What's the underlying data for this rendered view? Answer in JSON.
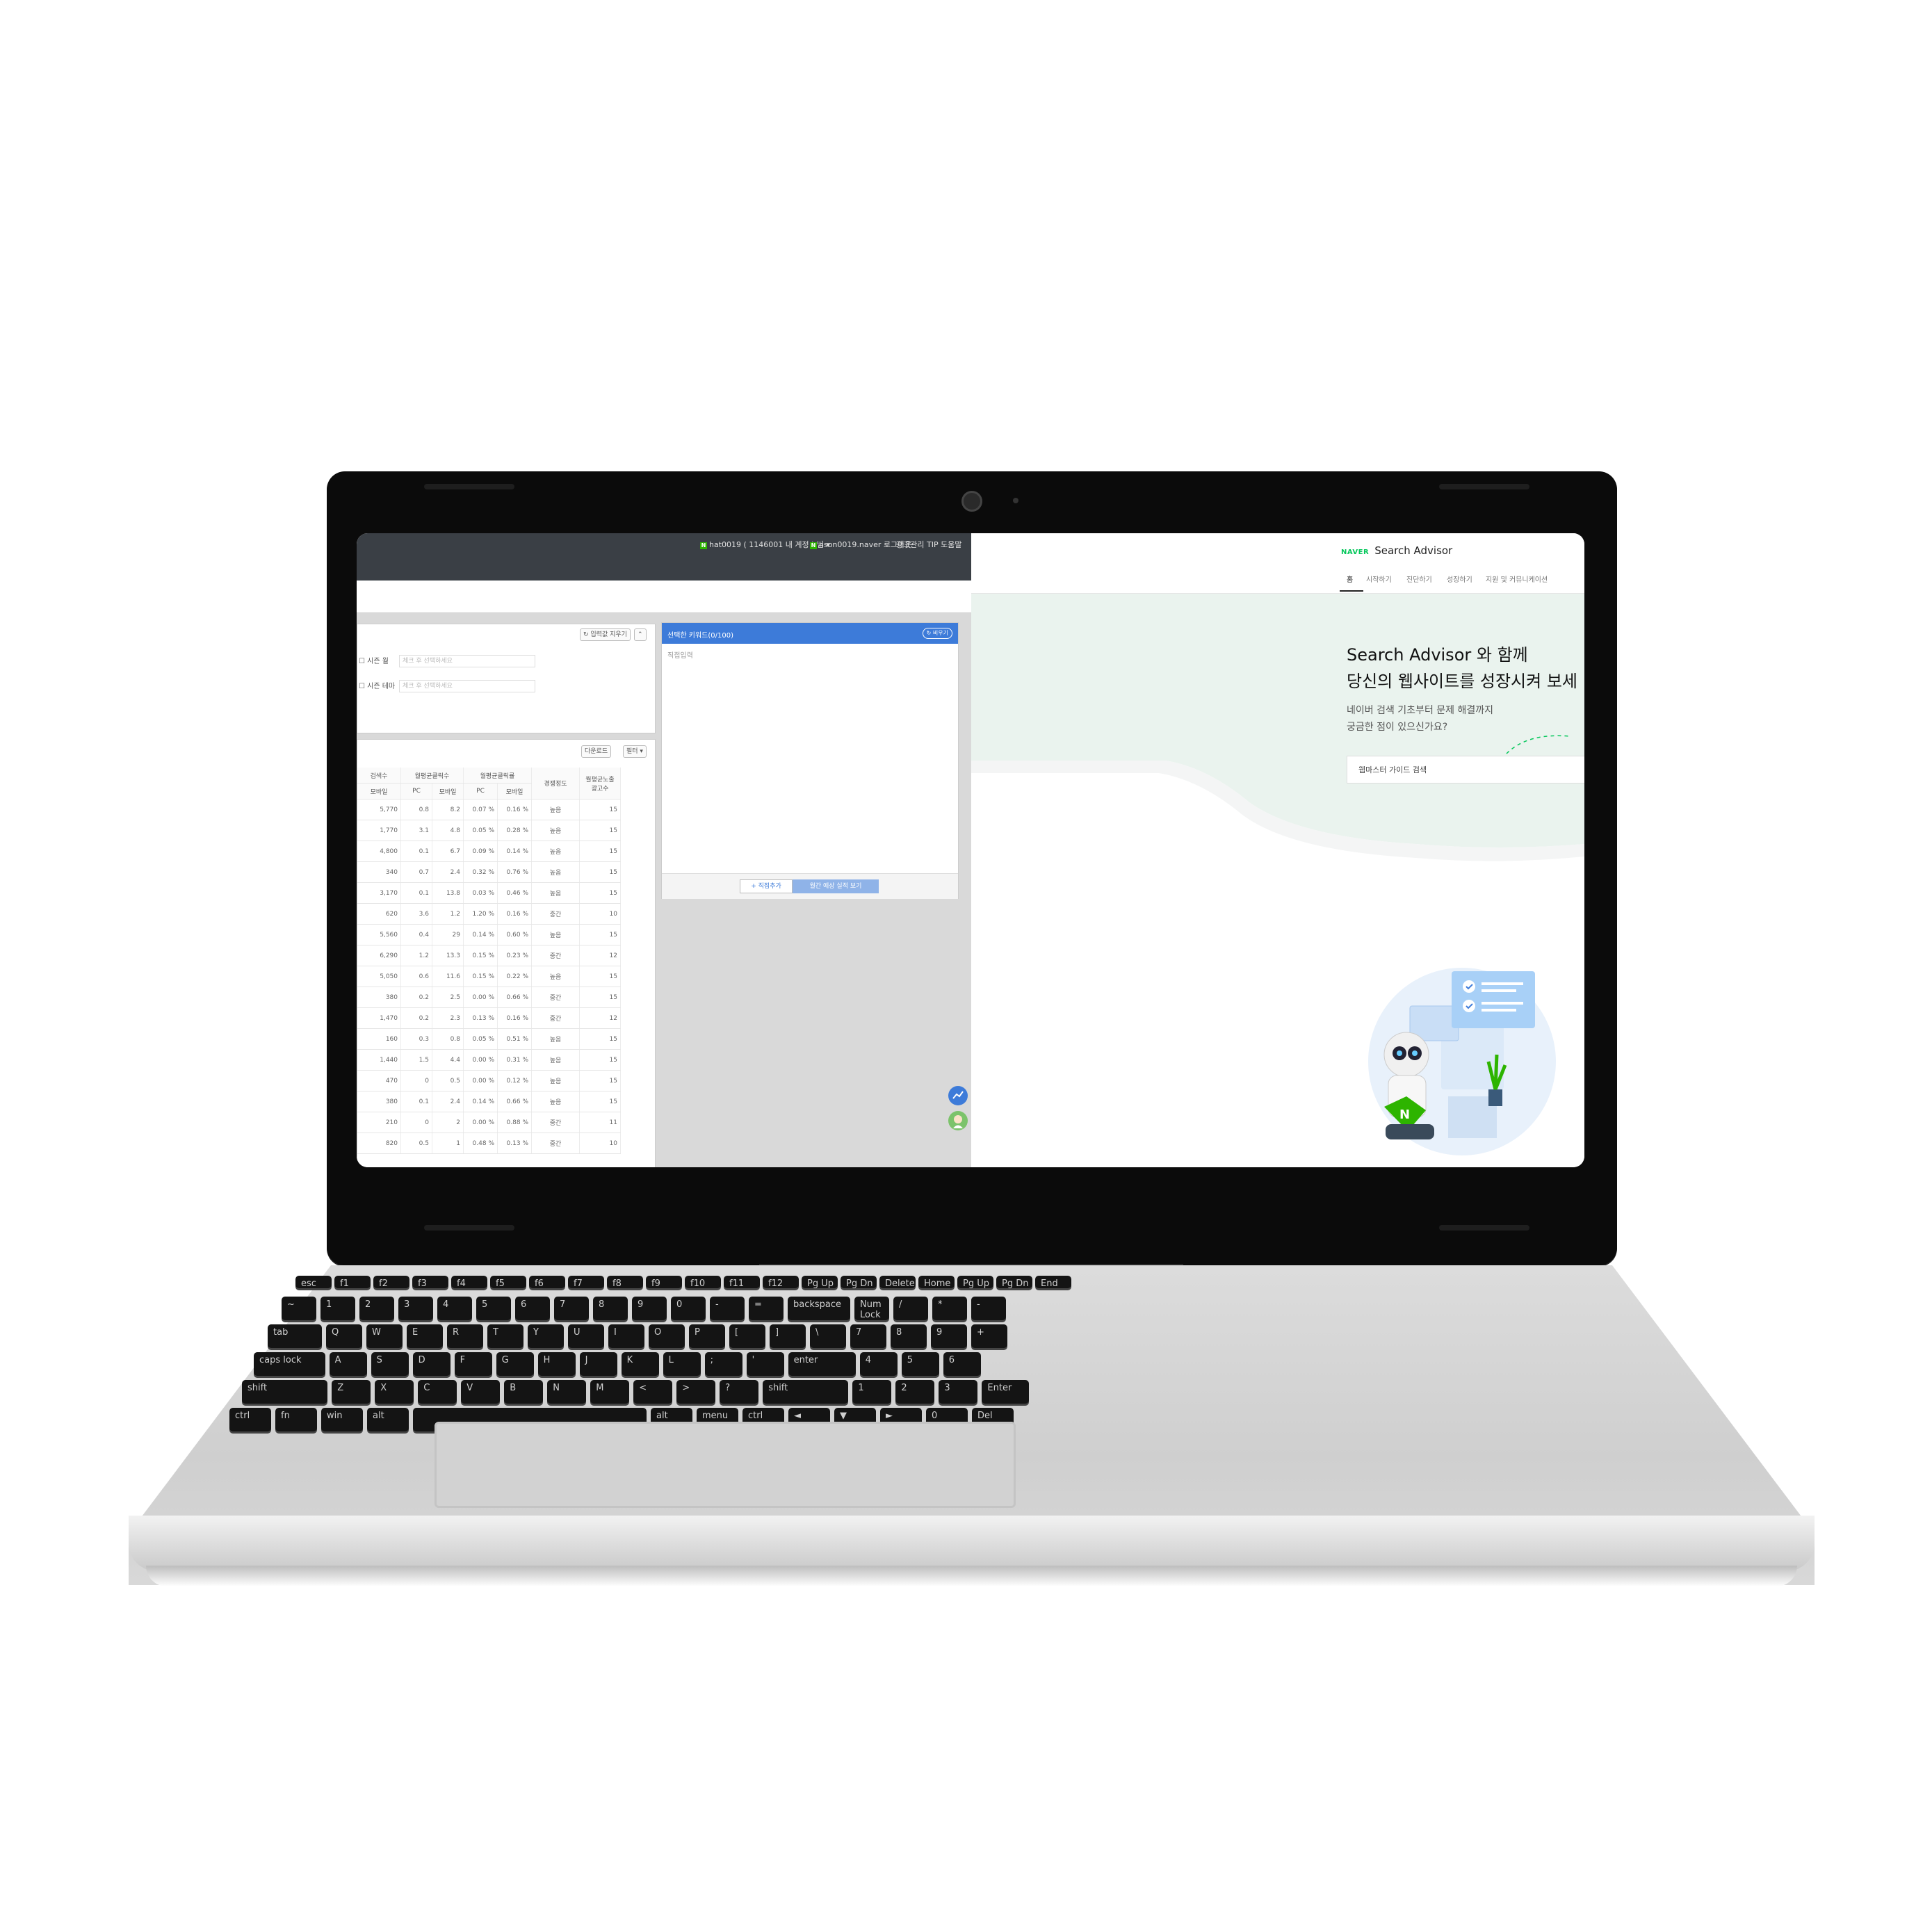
{
  "left_window": {
    "topbar": {
      "account_label": "hat0019 ( 1146001 내 계정 ) 님",
      "login_label": "hson0019.naver 로그아웃",
      "tip_label": "광고관리 TIP",
      "help_label": "도움말"
    },
    "filters": {
      "refresh_label": "입력값 지우기",
      "row1_label": "시즌 월",
      "row1_placeholder": "체크 후 선택하세요",
      "row2_label": "시즌 테마",
      "row2_placeholder": "체크 후 선택하세요"
    },
    "table_tools": {
      "download_label": "다운로드",
      "filter_label": "필터"
    },
    "table": {
      "group_headers": [
        "검색수",
        "월평균클릭수",
        "월평균클릭률",
        "경쟁정도",
        "월평균노출 광고수"
      ],
      "sub_headers": [
        "모바일",
        "PC",
        "모바일",
        "PC",
        "모바일"
      ],
      "rows": [
        [
          "5,770",
          "0.8",
          "8.2",
          "0.07 %",
          "0.16 %",
          "높음",
          "15"
        ],
        [
          "1,770",
          "3.1",
          "4.8",
          "0.05 %",
          "0.28 %",
          "높음",
          "15"
        ],
        [
          "4,800",
          "0.1",
          "6.7",
          "0.09 %",
          "0.14 %",
          "높음",
          "15"
        ],
        [
          "340",
          "0.7",
          "2.4",
          "0.32 %",
          "0.76 %",
          "높음",
          "15"
        ],
        [
          "3,170",
          "0.1",
          "13.8",
          "0.03 %",
          "0.46 %",
          "높음",
          "15"
        ],
        [
          "620",
          "3.6",
          "1.2",
          "1.20 %",
          "0.16 %",
          "중간",
          "10"
        ],
        [
          "5,560",
          "0.4",
          "29",
          "0.14 %",
          "0.60 %",
          "높음",
          "15"
        ],
        [
          "6,290",
          "1.2",
          "13.3",
          "0.15 %",
          "0.23 %",
          "중간",
          "12"
        ],
        [
          "5,050",
          "0.6",
          "11.6",
          "0.15 %",
          "0.22 %",
          "높음",
          "15"
        ],
        [
          "380",
          "0.2",
          "2.5",
          "0.00 %",
          "0.66 %",
          "중간",
          "15"
        ],
        [
          "1,470",
          "0.2",
          "2.3",
          "0.13 %",
          "0.16 %",
          "중간",
          "12"
        ],
        [
          "160",
          "0.3",
          "0.8",
          "0.05 %",
          "0.51 %",
          "높음",
          "15"
        ],
        [
          "1,440",
          "1.5",
          "4.4",
          "0.00 %",
          "0.31 %",
          "높음",
          "15"
        ],
        [
          "470",
          "0",
          "0.5",
          "0.00 %",
          "0.12 %",
          "높음",
          "15"
        ],
        [
          "380",
          "0.1",
          "2.4",
          "0.14 %",
          "0.66 %",
          "높음",
          "15"
        ],
        [
          "210",
          "0",
          "2",
          "0.00 %",
          "0.88 %",
          "중간",
          "11"
        ],
        [
          "820",
          "0.5",
          "1",
          "0.48 %",
          "0.13 %",
          "중간",
          "10"
        ]
      ]
    },
    "selected_panel": {
      "title": "선택한 키워드(0/100)",
      "reset_label": "비우기",
      "placeholder": "직접입력",
      "add_label": "+ 직접추가",
      "estimate_label": "월간 예상 실적 보기"
    },
    "colors": {
      "accent": "#3d7bd9",
      "topbar": "#3a3f45",
      "naver_green": "#2db400"
    }
  },
  "right_window": {
    "brand": "NAVER",
    "product": "Search Advisor",
    "nav": [
      "홈",
      "시작하기",
      "진단하기",
      "성장하기",
      "지원 및 커뮤니케이션"
    ],
    "hero_line1": "Search Advisor 와 함께",
    "hero_line2": "당신의 웹사이트를 성장시켜 보세",
    "hero_sub1": "네이버 검색 기초부터 문제 해결까지",
    "hero_sub2": "궁금한 점이 있으신가요?",
    "search_placeholder": "웹마스터 가이드 검색",
    "colors": {
      "hero_bg": "#eaf3ee",
      "brand_green": "#03c75a"
    }
  },
  "keyboard": {
    "rows": [
      [
        "esc",
        "f1",
        "f2",
        "f3",
        "f4",
        "f5",
        "f6",
        "f7",
        "f8",
        "f9",
        "f10",
        "f11",
        "f12",
        "Pg Up",
        "Pg Dn",
        "Delete",
        "Home",
        "Pg Up",
        "Pg Dn",
        "End"
      ],
      [
        "~",
        "1",
        "2",
        "3",
        "4",
        "5",
        "6",
        "7",
        "8",
        "9",
        "0",
        "-",
        "=",
        "backspace",
        "Num Lock",
        "/",
        "*",
        "-"
      ],
      [
        "tab",
        "Q",
        "W",
        "E",
        "R",
        "T",
        "Y",
        "U",
        "I",
        "O",
        "P",
        "[",
        "]",
        "\\",
        "7",
        "8",
        "9",
        "+"
      ],
      [
        "caps lock",
        "A",
        "S",
        "D",
        "F",
        "G",
        "H",
        "J",
        "K",
        "L",
        ";",
        "'",
        "enter",
        "4",
        "5",
        "6"
      ],
      [
        "shift",
        "Z",
        "X",
        "C",
        "V",
        "B",
        "N",
        "M",
        "<",
        ">",
        "?",
        "shift",
        "1",
        "2",
        "3",
        "Enter"
      ],
      [
        "ctrl",
        "fn",
        "win",
        "alt",
        "",
        "alt",
        "menu",
        "ctrl",
        "◄",
        "▼",
        "►",
        "0",
        "Del"
      ]
    ]
  }
}
